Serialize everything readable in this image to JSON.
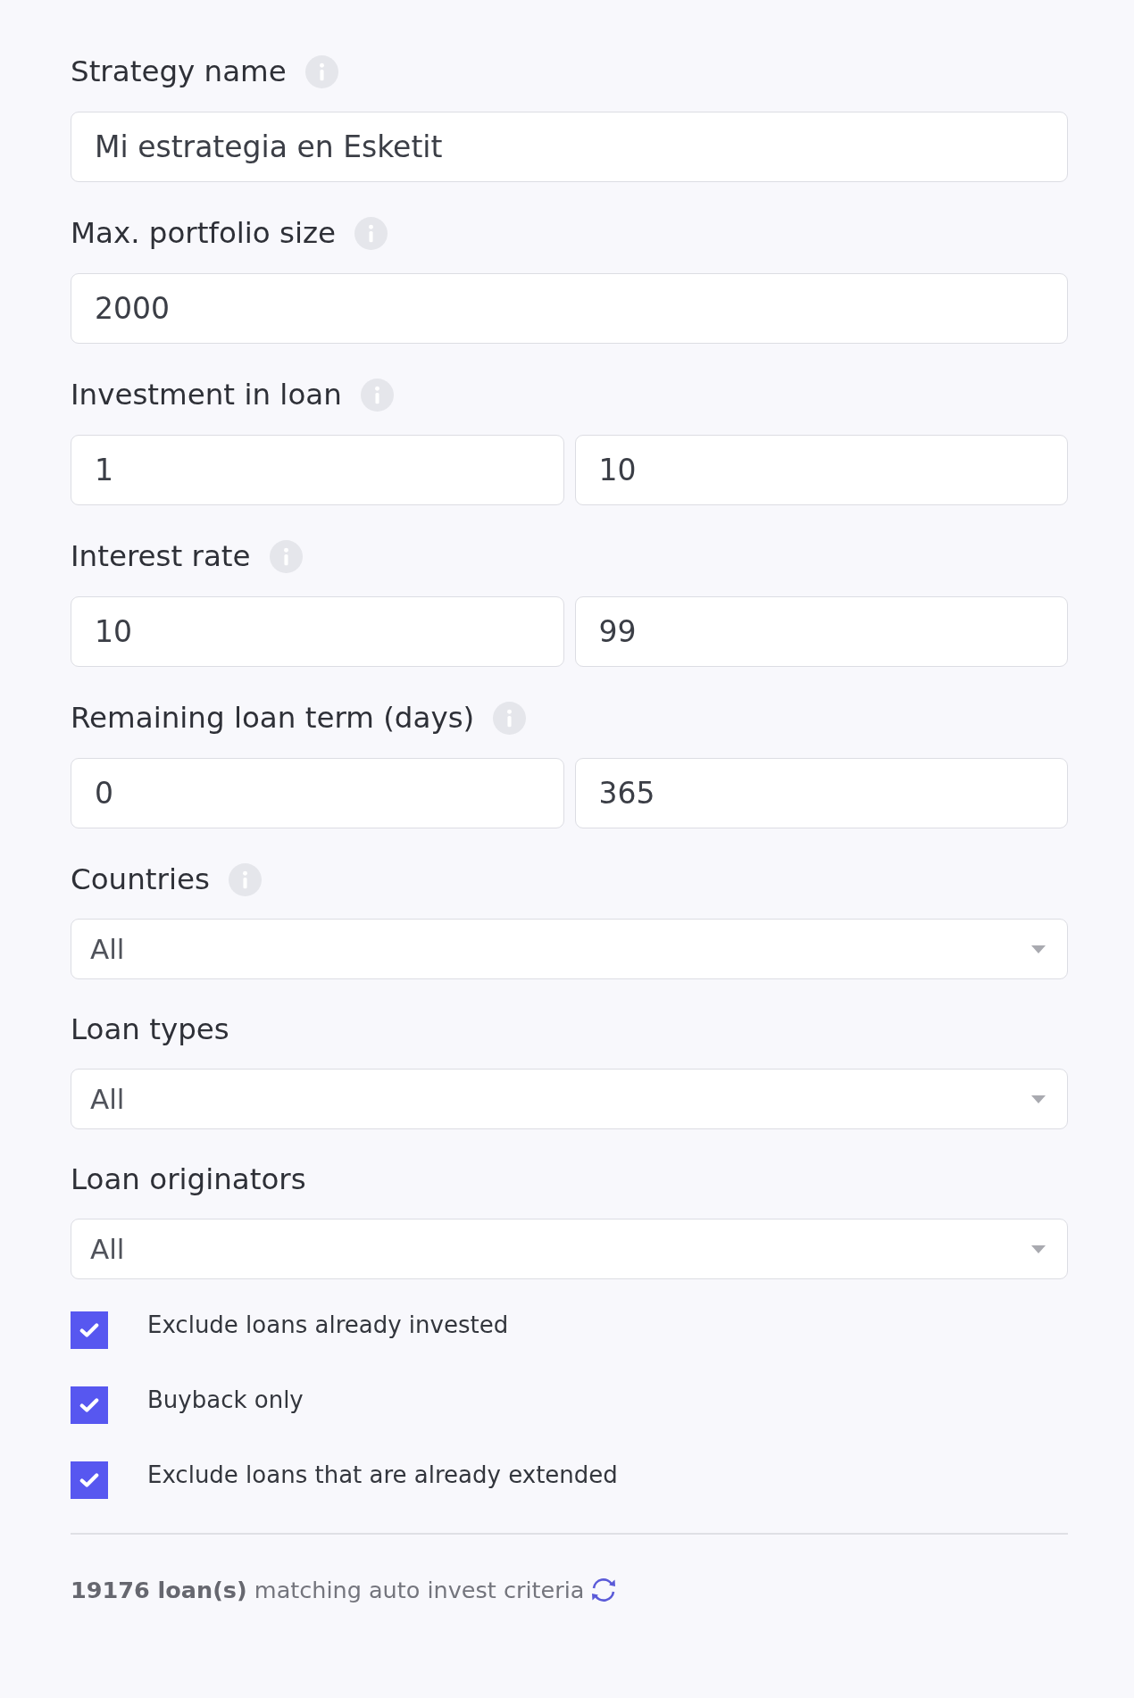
{
  "fields": [
    {
      "kind": "text",
      "label": "Strategy name",
      "info_icon": true,
      "value": "Mi estrategia en Esketit"
    },
    {
      "kind": "text",
      "label": "Max. portfolio size",
      "info_icon": true,
      "value": "2000"
    },
    {
      "kind": "range",
      "label": "Investment in loan",
      "info_icon": true,
      "values": [
        "1",
        "10"
      ]
    },
    {
      "kind": "range",
      "label": "Interest rate",
      "info_icon": true,
      "values": [
        "10",
        "99"
      ]
    },
    {
      "kind": "range",
      "label": "Remaining loan term (days)",
      "info_icon": true,
      "values": [
        "0",
        "365"
      ]
    },
    {
      "kind": "select",
      "label": "Countries",
      "info_icon": true,
      "value": "All"
    },
    {
      "kind": "select",
      "label": "Loan types",
      "info_icon": false,
      "value": "All"
    },
    {
      "kind": "select",
      "label": "Loan originators",
      "info_icon": false,
      "value": "All"
    }
  ],
  "options": [
    {
      "label": "Exclude loans already invested",
      "checked": true
    },
    {
      "label": "Buyback only",
      "checked": true
    },
    {
      "label": "Exclude loans that are already extended",
      "checked": true
    }
  ],
  "summary": "**19176 loan(s)** matching auto invest criteria"
}
